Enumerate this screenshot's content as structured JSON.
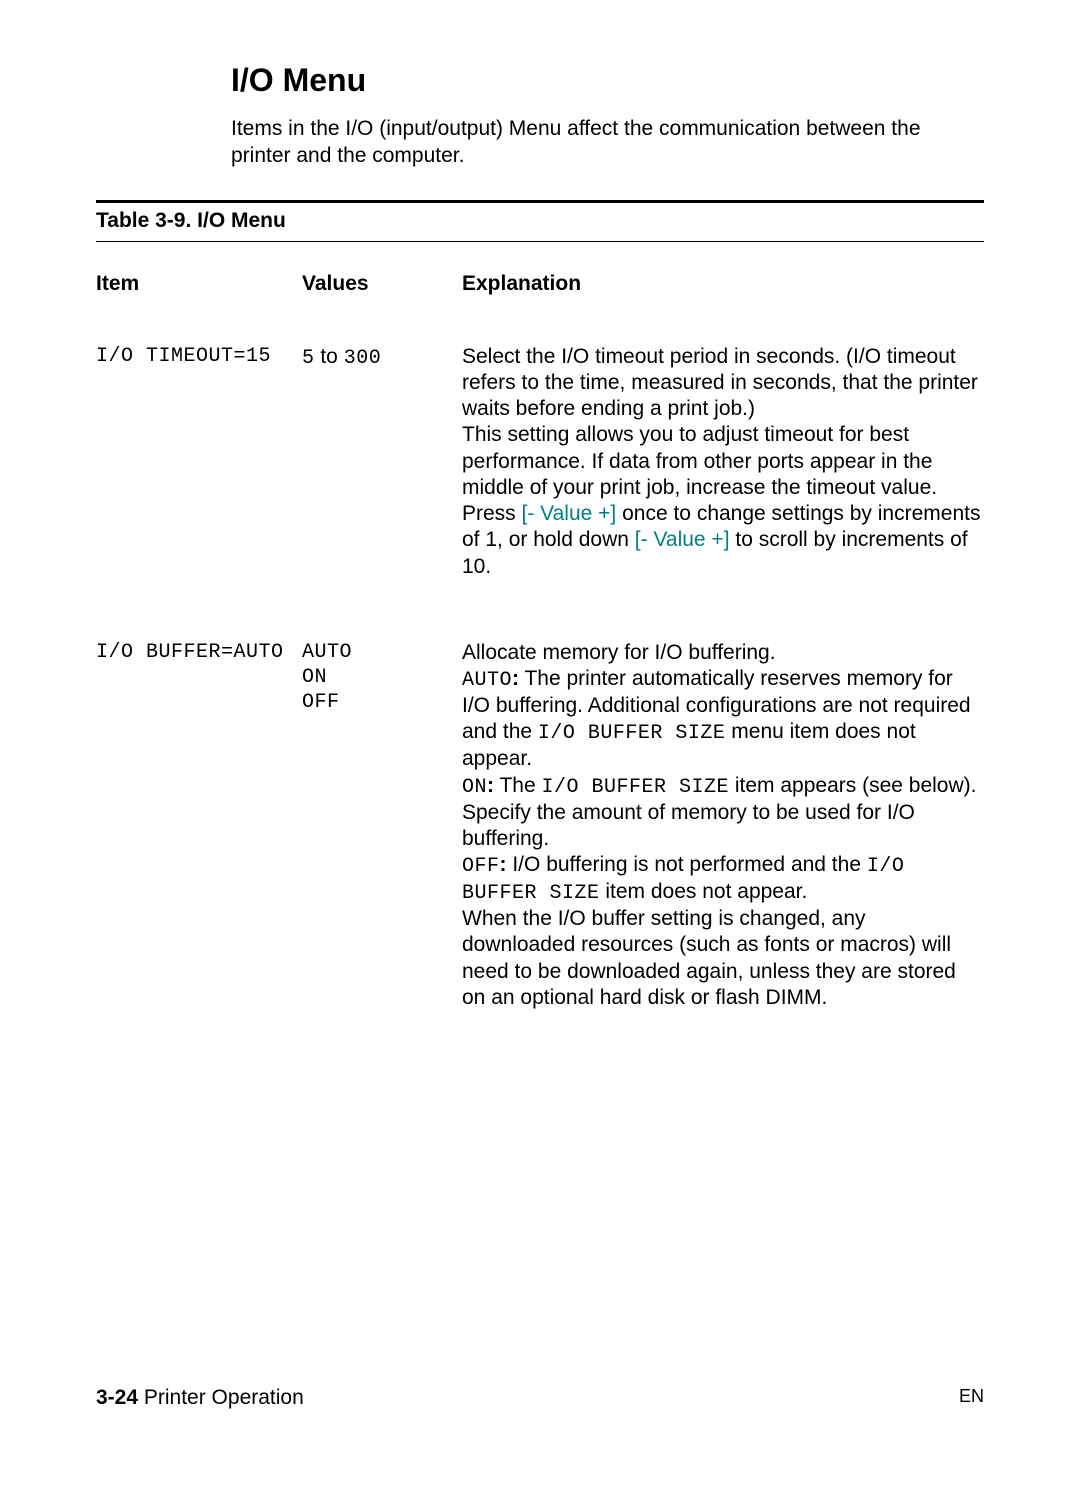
{
  "section_title": "I/O Menu",
  "intro": "Items in the I/O (input/output) Menu affect the communication between the printer and the computer.",
  "table_caption": "Table 3-9. I/O Menu",
  "headers": {
    "item": "Item",
    "values": "Values",
    "explanation": "Explanation"
  },
  "rows": [
    {
      "item": "I/O TIMEOUT=15",
      "values_pre": "5",
      "values_mid": " to ",
      "values_post": "300",
      "expl": {
        "p1": "Select the I/O timeout period in seconds. (I/O timeout refers to the time, measured in seconds, that the printer waits before ending a print job.)",
        "p2": "This setting allows you to adjust timeout for best performance. If data from other ports appear in the middle of your print job, increase the timeout value.",
        "p3a": "Press ",
        "p3btn1": "[- Value +]",
        "p3b": " once to change settings by increments of 1, or hold down ",
        "p3btn2": "[- Value +]",
        "p3c": " to scroll by increments of 10."
      }
    },
    {
      "item": "I/O BUFFER=AUTO",
      "values_line1": "AUTO",
      "values_line2": "ON",
      "values_line3": "OFF",
      "expl": {
        "p1": "Allocate memory for I/O buffering.",
        "p2a_code": "AUTO",
        "p2a_bold": ":",
        "p2a": " The printer automatically reserves memory for I/O buffering. Additional configurations are not required and the ",
        "p2a_code2": "I/O BUFFER SIZE",
        "p2a_tail": " menu item does not appear.",
        "p3a_code": "ON",
        "p3a_bold": ":",
        "p3a": " The ",
        "p3a_code2": "I/O BUFFER SIZE",
        "p3a_tail": " item appears (see below). Specify the amount of memory to be used for I/O buffering.",
        "p4a_code": "OFF",
        "p4a_bold": ":",
        "p4a": " I/O buffering is not performed and the ",
        "p4a_code2": "I/O BUFFER SIZE",
        "p4a_tail": " item does not appear.",
        "p5": "When the I/O buffer setting is changed, any downloaded resources (such as fonts or macros) will need to be downloaded again, unless they are stored on an optional hard disk or flash DIMM."
      }
    }
  ],
  "footer": {
    "page_num": "3-24",
    "section": " Printer Operation",
    "lang": "EN"
  }
}
